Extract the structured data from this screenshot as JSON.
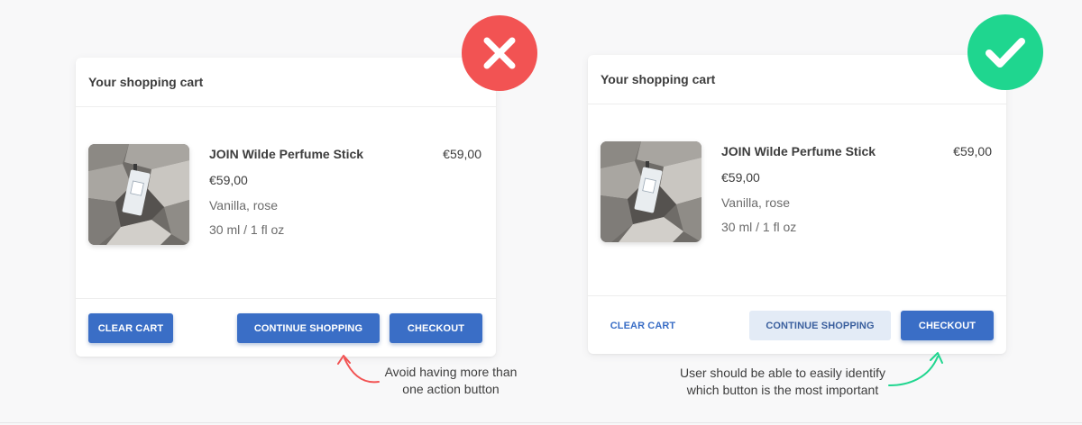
{
  "examples": [
    {
      "id": "wrong",
      "badge_icon": "cross-icon",
      "badge_color": "#f25353",
      "card": {
        "title": "Your shopping cart",
        "product": {
          "name": "JOIN Wilde Perfume Stick",
          "total": "€59,00",
          "price": "€59,00",
          "variant": "Vanilla, rose",
          "size": "30 ml / 1 fl oz"
        },
        "buttons": {
          "clear": "CLEAR CART",
          "continue": "CONTINUE SHOPPING",
          "checkout": "CHECKOUT"
        }
      },
      "note_lines": [
        "Avoid having more than",
        "one action button"
      ],
      "note_color": "#f25353"
    },
    {
      "id": "right",
      "badge_icon": "check-icon",
      "badge_color": "#1fd68f",
      "card": {
        "title": "Your shopping cart",
        "product": {
          "name": "JOIN Wilde Perfume Stick",
          "total": "€59,00",
          "price": "€59,00",
          "variant": "Vanilla, rose",
          "size": "30 ml / 1 fl oz"
        },
        "buttons": {
          "clear": "CLEAR CART",
          "continue": "CONTINUE SHOPPING",
          "checkout": "CHECKOUT"
        }
      },
      "note_lines": [
        "User should be able to easily identify",
        "which button is the most important"
      ],
      "note_color": "#1fd68f"
    }
  ],
  "colors": {
    "primary": "#3a6ec6",
    "secondary_bg": "#e3ebf6"
  }
}
